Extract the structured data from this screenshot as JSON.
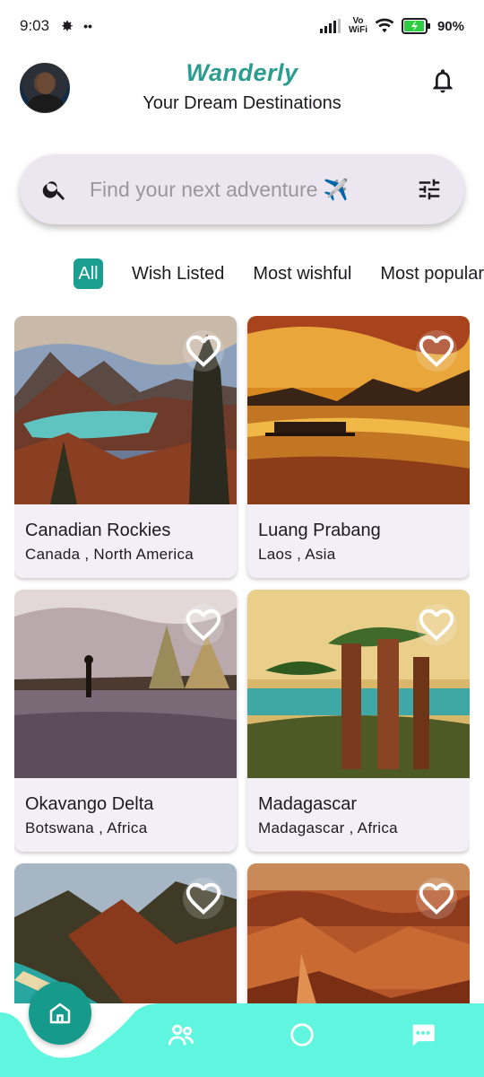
{
  "status_bar": {
    "time": "9:03",
    "battery": "90%",
    "network_label_top": "Vo",
    "network_label_bottom": "WiFi"
  },
  "header": {
    "title": "Wanderly",
    "subtitle": "Your Dream Destinations"
  },
  "search": {
    "placeholder": "Find your next adventure ✈️"
  },
  "chips": [
    {
      "label": "All",
      "active": true
    },
    {
      "label": "Wish Listed",
      "active": false
    },
    {
      "label": "Most wishful",
      "active": false
    },
    {
      "label": "Most popular",
      "active": false
    }
  ],
  "destinations": [
    {
      "name": "Canadian Rockies",
      "location": "Canada , North America"
    },
    {
      "name": "Luang Prabang",
      "location": "Laos , Asia"
    },
    {
      "name": "Okavango Delta",
      "location": "Botswana , Africa"
    },
    {
      "name": "Madagascar",
      "location": "Madagascar , Africa"
    },
    {
      "name": "",
      "location": ""
    },
    {
      "name": "",
      "location": ""
    }
  ],
  "colors": {
    "accent": "#1a9e8f",
    "title": "#2a9d8f",
    "nav_bg": "#5ff5df",
    "card_bg": "#f4eff6",
    "search_bg": "#ece6f0"
  },
  "icons": {
    "bell": "bell-icon",
    "search": "search-icon",
    "filter": "tune-icon",
    "heart": "heart-outline-icon",
    "home": "home-icon",
    "people": "people-icon",
    "circle": "circle-icon",
    "chat": "chat-icon"
  }
}
